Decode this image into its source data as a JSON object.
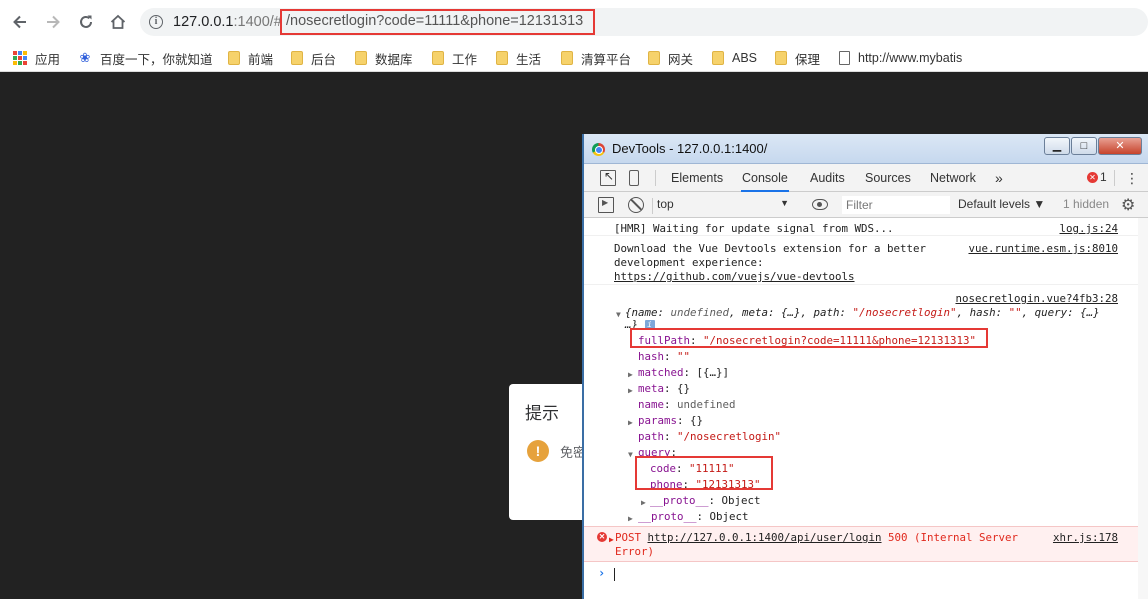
{
  "browser": {
    "url_host": "127.0.0.1",
    "url_port_hash": ":1400/#",
    "url_path": "/nosecretlogin?code=11111&phone=12131313",
    "bookmarks": [
      {
        "label": "应用",
        "icon": "apps-icon"
      },
      {
        "label": "百度一下，你就知道",
        "icon": "paw-icon"
      },
      {
        "label": "前端",
        "icon": "folder-icon"
      },
      {
        "label": "后台",
        "icon": "folder-icon"
      },
      {
        "label": "数据库",
        "icon": "folder-icon"
      },
      {
        "label": "工作",
        "icon": "folder-icon"
      },
      {
        "label": "生活",
        "icon": "folder-icon"
      },
      {
        "label": "清算平台",
        "icon": "folder-icon"
      },
      {
        "label": "网关",
        "icon": "folder-icon"
      },
      {
        "label": "ABS",
        "icon": "folder-icon"
      },
      {
        "label": "保理",
        "icon": "folder-icon"
      },
      {
        "label": "http://www.mybatis",
        "icon": "page-icon"
      }
    ]
  },
  "dialog": {
    "title": "提示",
    "message": "免密"
  },
  "devtools": {
    "window_title": "DevTools - 127.0.0.1:1400/",
    "tabs": [
      "Elements",
      "Console",
      "Audits",
      "Sources",
      "Network"
    ],
    "active_tab": "Console",
    "more_tabs": "»",
    "error_count": "1",
    "context": "top",
    "filter_placeholder": "Filter",
    "levels": "Default levels ▼",
    "hidden": "1 hidden",
    "messages": {
      "hmr_text": "[HMR] Waiting for update signal from WDS...",
      "hmr_src": "log.js:24",
      "vue_line1": "Download the Vue Devtools extension for a better",
      "vue_line2": "development experience:",
      "vue_link": "https://github.com/vuejs/vue-devtools",
      "vue_src": "vue.runtime.esm.js:8010",
      "route_src": "nosecretlogin.vue?4fb3:28",
      "route_summary_a": "{name: ",
      "route_summary_b": "undefined",
      "route_summary_c": ", meta: {…}, path: ",
      "route_summary_d": "\"/nosecretlogin\"",
      "route_summary_e": ", hash: ",
      "route_summary_f": "\"\"",
      "route_summary_g": ", query: {…}",
      "route_summary_h": "…}",
      "props": {
        "fullPath_key": "fullPath",
        "fullPath_val": "\"/nosecretlogin?code=11111&phone=12131313\"",
        "hash_key": "hash",
        "hash_val": "\"\"",
        "matched_key": "matched",
        "matched_val": "[{…}]",
        "meta_key": "meta",
        "meta_val": "{}",
        "name_key": "name",
        "name_val": "undefined",
        "params_key": "params",
        "params_val": "{}",
        "path_key": "path",
        "path_val": "\"/nosecretlogin\"",
        "query_key": "query",
        "code_key": "code",
        "code_val": "\"11111\"",
        "phone_key": "phone",
        "phone_val": "\"12131313\"",
        "proto_key": "__proto__",
        "proto_val": "Object"
      },
      "error_line1_a": "POST ",
      "error_url": "http://127.0.0.1:1400/api/user/login",
      "error_line1_b": " 500 (Internal Server",
      "error_line2": "Error)",
      "error_src": "xhr.js:178"
    }
  }
}
